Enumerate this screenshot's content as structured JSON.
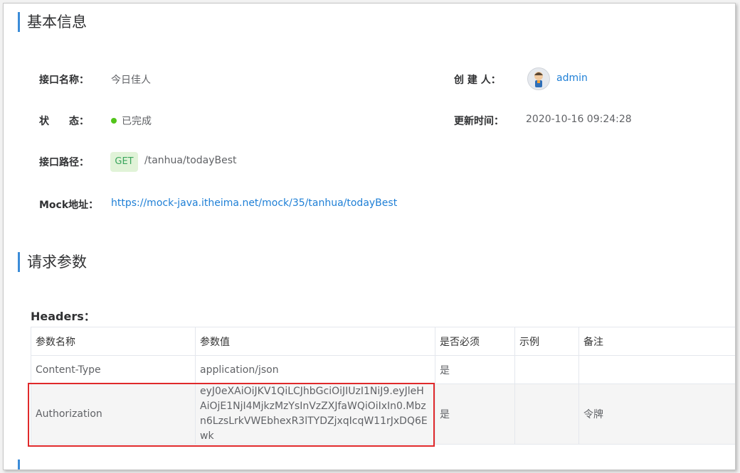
{
  "sections": {
    "basic_info": "基本信息",
    "request_params": "请求参数"
  },
  "basic": {
    "name_label": "接口名称：",
    "name_value": "今日佳人",
    "creator_label": "创 建 人：",
    "creator_value": "admin",
    "status_label": "状　　态：",
    "status_value": "已完成",
    "updated_label": "更新时间：",
    "updated_value": "2020-10-16 09:24:28",
    "path_label": "接口路径：",
    "method": "GET",
    "path_value": "/tanhua/todayBest",
    "mock_label": "Mock地址：",
    "mock_value": "https://mock-java.itheima.net/mock/35/tanhua/todayBest"
  },
  "headers": {
    "title": "Headers：",
    "columns": [
      "参数名称",
      "参数值",
      "是否必须",
      "示例",
      "备注"
    ],
    "rows": [
      {
        "name": "Content-Type",
        "value": "application/json",
        "required": "是",
        "example": "",
        "note": ""
      },
      {
        "name": "Authorization",
        "value": "eyJ0eXAiOiJKV1QiLCJhbGciOiJIUzI1NiJ9.eyJleHAiOjE1NjI4MjkzMzYsInVzZXJfaWQiOiIxIn0.Mbzn6LzsLrkVWEbhexR3lTYDZjxqIcqW11rJxDQ6Ewk",
        "required": "是",
        "example": "",
        "note": "令牌"
      }
    ]
  },
  "colors": {
    "accent": "#3b8cd8",
    "link": "#1e7fd6",
    "status_done": "#52c41a",
    "get_badge_bg": "#e1f3d8",
    "get_badge_text": "#3aa55d",
    "highlight": "#e0292b"
  },
  "icons": {
    "avatar": "avatar-icon",
    "status": "status-dot-icon"
  }
}
